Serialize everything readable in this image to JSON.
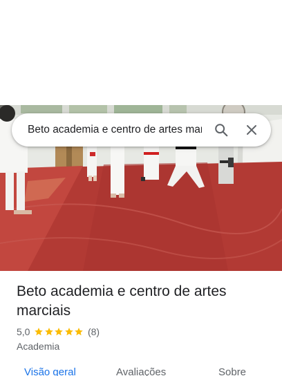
{
  "search": {
    "query": "Beto academia e centro de artes marciais"
  },
  "place": {
    "name": "Beto academia e centro de artes marciais",
    "rating": "5,0",
    "review_count": "(8)",
    "category": "Academia",
    "stars": 5
  },
  "tabs": [
    {
      "label": "Visão geral",
      "active": true
    },
    {
      "label": "Avaliações",
      "active": false
    },
    {
      "label": "Sobre",
      "active": false
    }
  ],
  "colors": {
    "accent": "#1a73e8",
    "star": "#fbbc04",
    "text_secondary": "#5f6368"
  }
}
